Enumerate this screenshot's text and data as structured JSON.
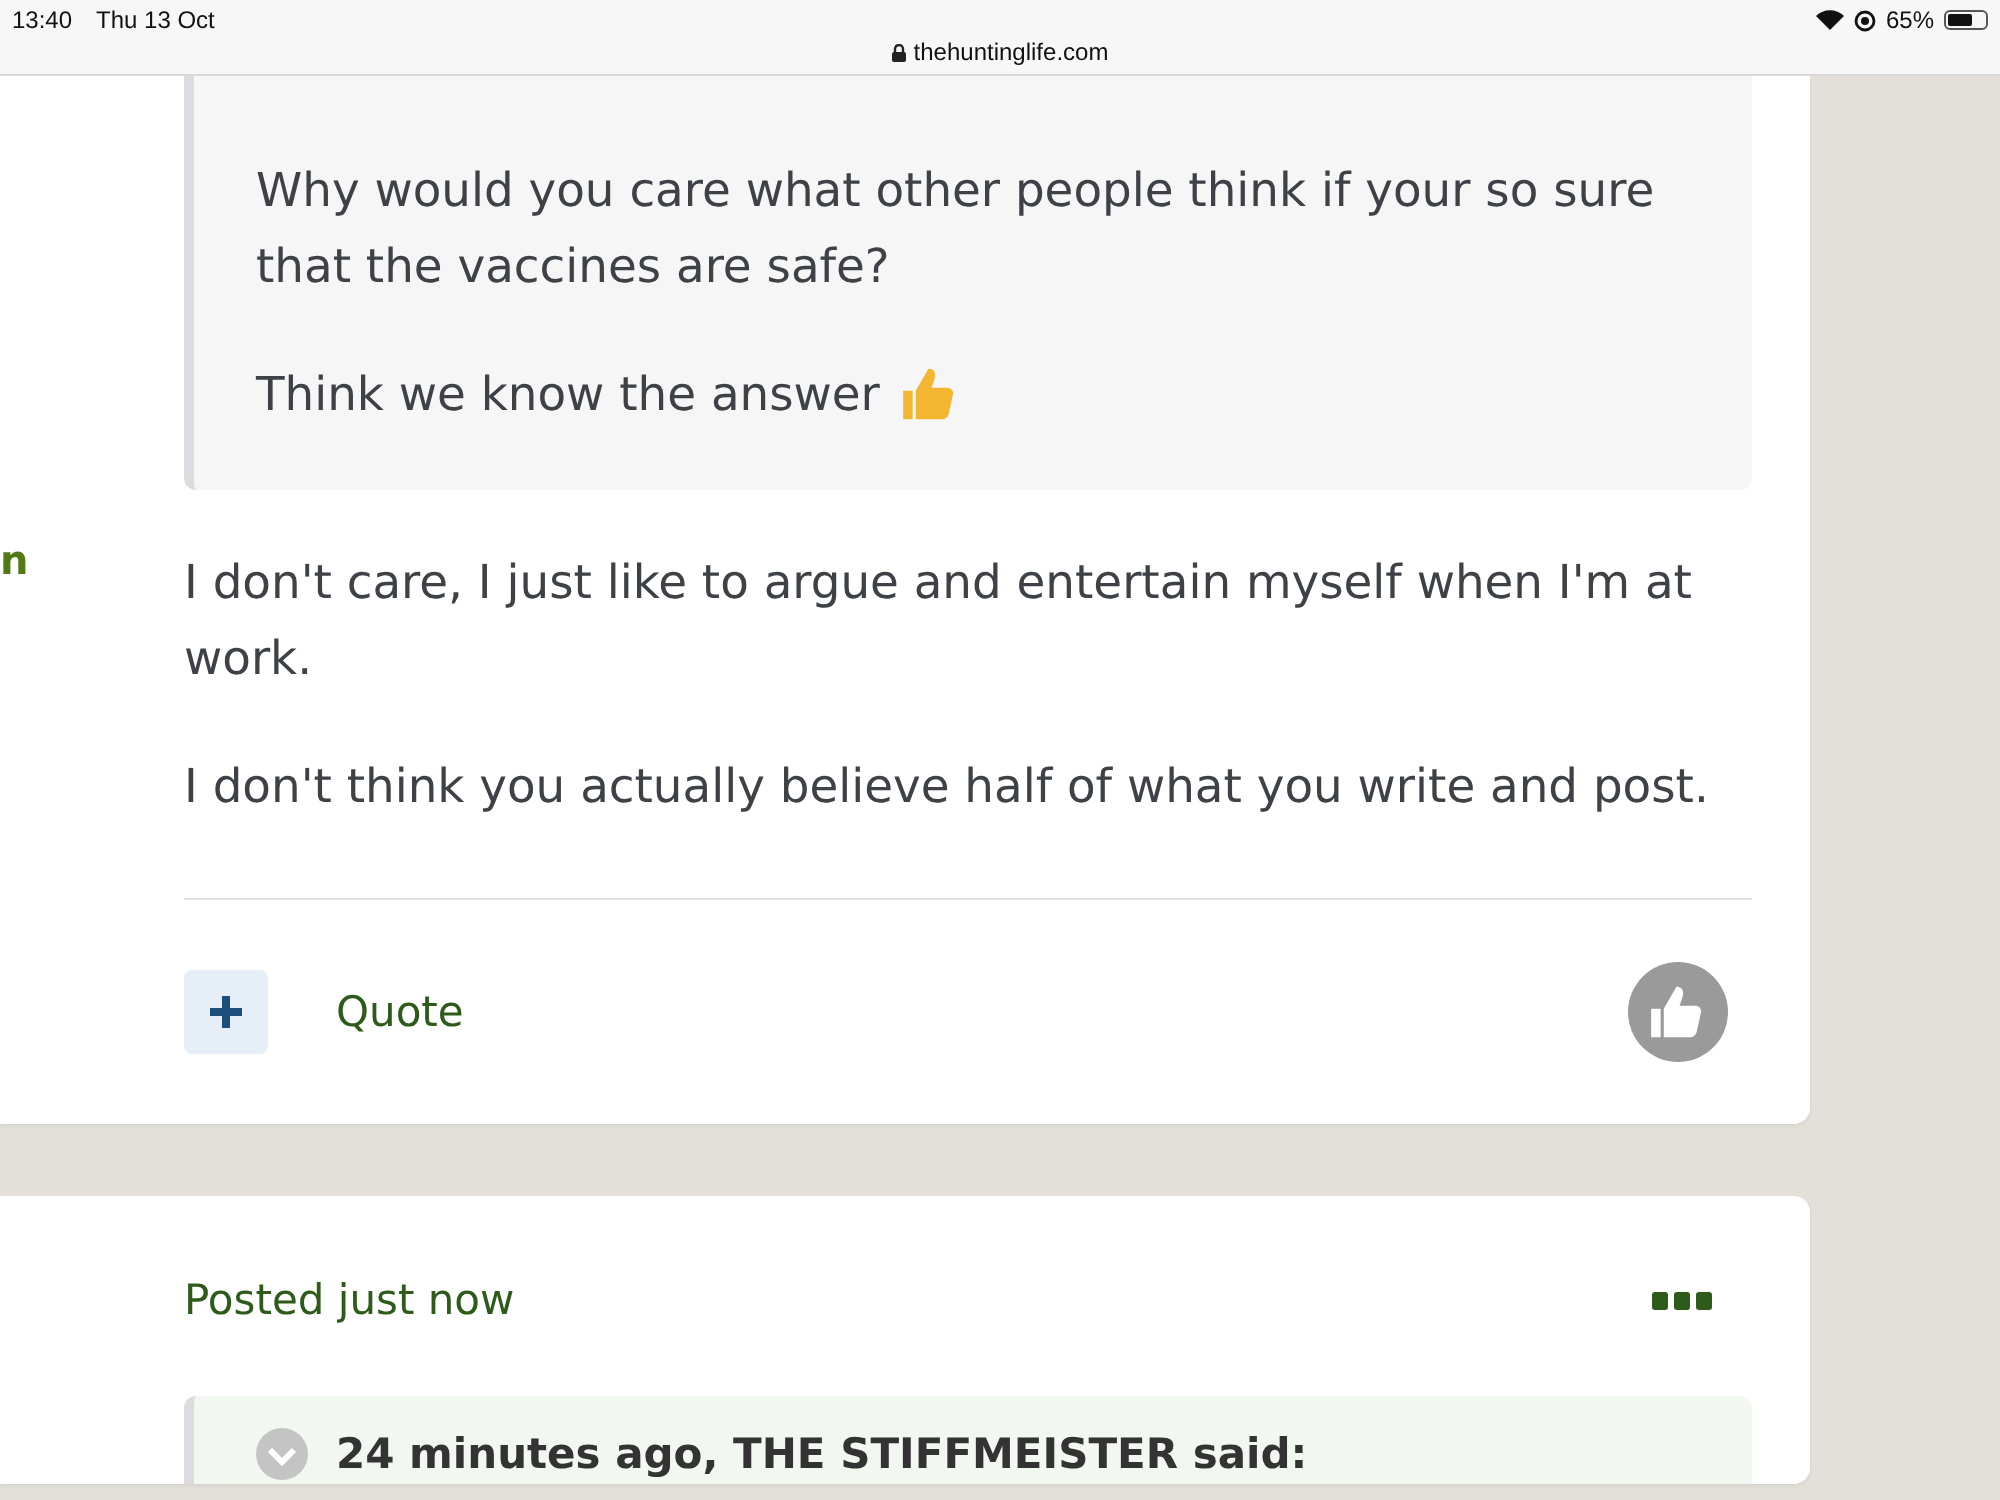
{
  "status_bar": {
    "time": "13:40",
    "date": "Thu 13 Oct",
    "url": "thehuntinglife.com",
    "battery": "65%"
  },
  "posts": [
    {
      "author": "n",
      "quote": {
        "paragraphs": [
          "Why would you care what other people think if your so sure that the vaccines are safe?",
          "Think we know the answer"
        ]
      },
      "paragraphs": [
        "I don't care, I just like to argue and entertain myself when I'm at work.",
        "I don't think you actually believe half of what you write and post."
      ],
      "quote_label": "Quote"
    },
    {
      "posted": "Posted just now",
      "quote": {
        "header": "24 minutes ago, THE STIFFMEISTER said:"
      }
    }
  ]
}
